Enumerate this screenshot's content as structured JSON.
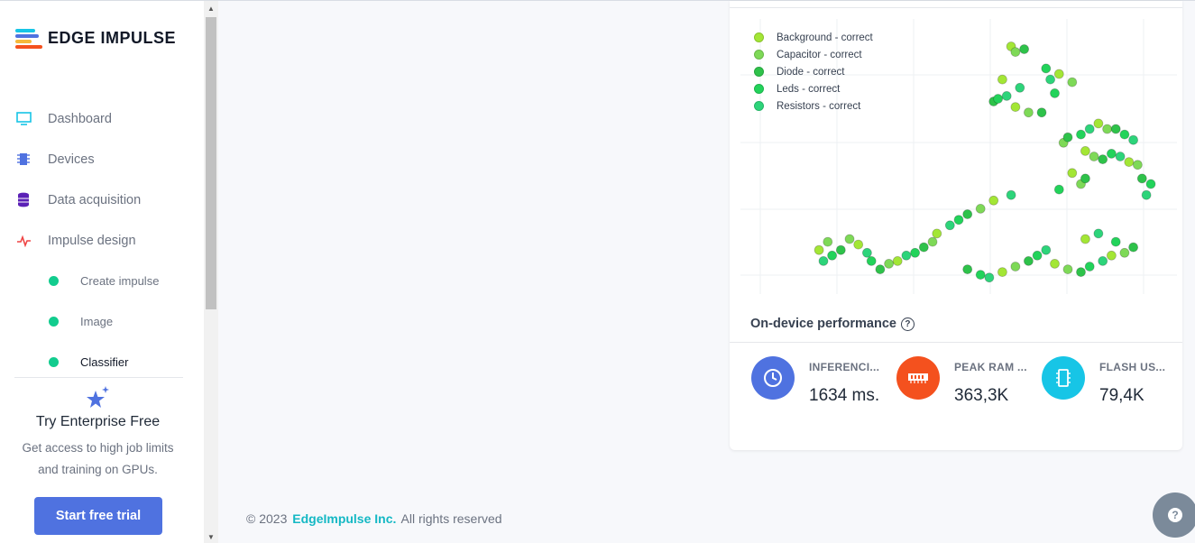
{
  "brand": {
    "name": "EDGE IMPULSE"
  },
  "sidebar": {
    "items": [
      {
        "label": "Dashboard",
        "icon": "monitor-icon"
      },
      {
        "label": "Devices",
        "icon": "chip-icon"
      },
      {
        "label": "Data acquisition",
        "icon": "database-icon"
      },
      {
        "label": "Impulse design",
        "icon": "pulse-icon"
      }
    ],
    "sub_items": [
      {
        "label": "Create impulse",
        "active": false
      },
      {
        "label": "Image",
        "active": false
      },
      {
        "label": "Classifier",
        "active": true
      }
    ],
    "promo": {
      "title": "Try Enterprise Free",
      "text": "Get access to high job limits and training on GPUs.",
      "button": "Start free trial"
    }
  },
  "chart_data": {
    "type": "scatter",
    "grid": true,
    "legend_position": "top-left",
    "series": [
      {
        "name": "Background - correct",
        "color": "#a3e635"
      },
      {
        "name": "Capacitor - correct",
        "color": "#7ed957"
      },
      {
        "name": "Diode - correct",
        "color": "#2ec24a"
      },
      {
        "name": "Leds - correct",
        "color": "#22d35a"
      },
      {
        "name": "Resistors - correct",
        "color": "#2dd47a"
      }
    ],
    "points": [
      [
        0.62,
        0.9
      ],
      [
        0.63,
        0.88
      ],
      [
        0.65,
        0.89
      ],
      [
        0.7,
        0.82
      ],
      [
        0.71,
        0.78
      ],
      [
        0.73,
        0.8
      ],
      [
        0.76,
        0.77
      ],
      [
        0.58,
        0.7
      ],
      [
        0.59,
        0.71
      ],
      [
        0.61,
        0.72
      ],
      [
        0.63,
        0.68
      ],
      [
        0.66,
        0.66
      ],
      [
        0.69,
        0.66
      ],
      [
        0.72,
        0.73
      ],
      [
        0.64,
        0.75
      ],
      [
        0.6,
        0.78
      ],
      [
        0.74,
        0.55
      ],
      [
        0.75,
        0.57
      ],
      [
        0.78,
        0.58
      ],
      [
        0.8,
        0.6
      ],
      [
        0.82,
        0.62
      ],
      [
        0.84,
        0.6
      ],
      [
        0.86,
        0.6
      ],
      [
        0.88,
        0.58
      ],
      [
        0.9,
        0.56
      ],
      [
        0.79,
        0.52
      ],
      [
        0.81,
        0.5
      ],
      [
        0.83,
        0.49
      ],
      [
        0.85,
        0.51
      ],
      [
        0.87,
        0.5
      ],
      [
        0.89,
        0.48
      ],
      [
        0.91,
        0.47
      ],
      [
        0.92,
        0.42
      ],
      [
        0.94,
        0.4
      ],
      [
        0.93,
        0.36
      ],
      [
        0.76,
        0.44
      ],
      [
        0.78,
        0.4
      ],
      [
        0.79,
        0.42
      ],
      [
        0.73,
        0.38
      ],
      [
        0.62,
        0.36
      ],
      [
        0.58,
        0.34
      ],
      [
        0.55,
        0.31
      ],
      [
        0.52,
        0.29
      ],
      [
        0.5,
        0.27
      ],
      [
        0.48,
        0.25
      ],
      [
        0.45,
        0.22
      ],
      [
        0.44,
        0.19
      ],
      [
        0.42,
        0.17
      ],
      [
        0.4,
        0.15
      ],
      [
        0.38,
        0.14
      ],
      [
        0.36,
        0.12
      ],
      [
        0.34,
        0.11
      ],
      [
        0.32,
        0.09
      ],
      [
        0.3,
        0.12
      ],
      [
        0.29,
        0.15
      ],
      [
        0.27,
        0.18
      ],
      [
        0.25,
        0.2
      ],
      [
        0.23,
        0.16
      ],
      [
        0.21,
        0.14
      ],
      [
        0.19,
        0.12
      ],
      [
        0.18,
        0.16
      ],
      [
        0.2,
        0.19
      ],
      [
        0.52,
        0.09
      ],
      [
        0.55,
        0.07
      ],
      [
        0.57,
        0.06
      ],
      [
        0.6,
        0.08
      ],
      [
        0.63,
        0.1
      ],
      [
        0.66,
        0.12
      ],
      [
        0.68,
        0.14
      ],
      [
        0.7,
        0.16
      ],
      [
        0.72,
        0.11
      ],
      [
        0.75,
        0.09
      ],
      [
        0.78,
        0.08
      ],
      [
        0.8,
        0.1
      ],
      [
        0.83,
        0.12
      ],
      [
        0.85,
        0.14
      ],
      [
        0.88,
        0.15
      ],
      [
        0.9,
        0.17
      ],
      [
        0.86,
        0.19
      ],
      [
        0.82,
        0.22
      ],
      [
        0.79,
        0.2
      ]
    ]
  },
  "performance": {
    "title": "On-device performance",
    "metrics": [
      {
        "label": "INFERENCI...",
        "value": "1634 ms.",
        "color": "#4f72e0",
        "icon": "clock-icon"
      },
      {
        "label": "PEAK RAM ...",
        "value": "363,3K",
        "color": "#f4511e",
        "icon": "ram-icon"
      },
      {
        "label": "FLASH US...",
        "value": "79,4K",
        "color": "#17c5e6",
        "icon": "flash-chip-icon"
      }
    ]
  },
  "footer": {
    "prefix": "© 2023",
    "company": "EdgeImpulse Inc.",
    "suffix": "All rights reserved"
  }
}
